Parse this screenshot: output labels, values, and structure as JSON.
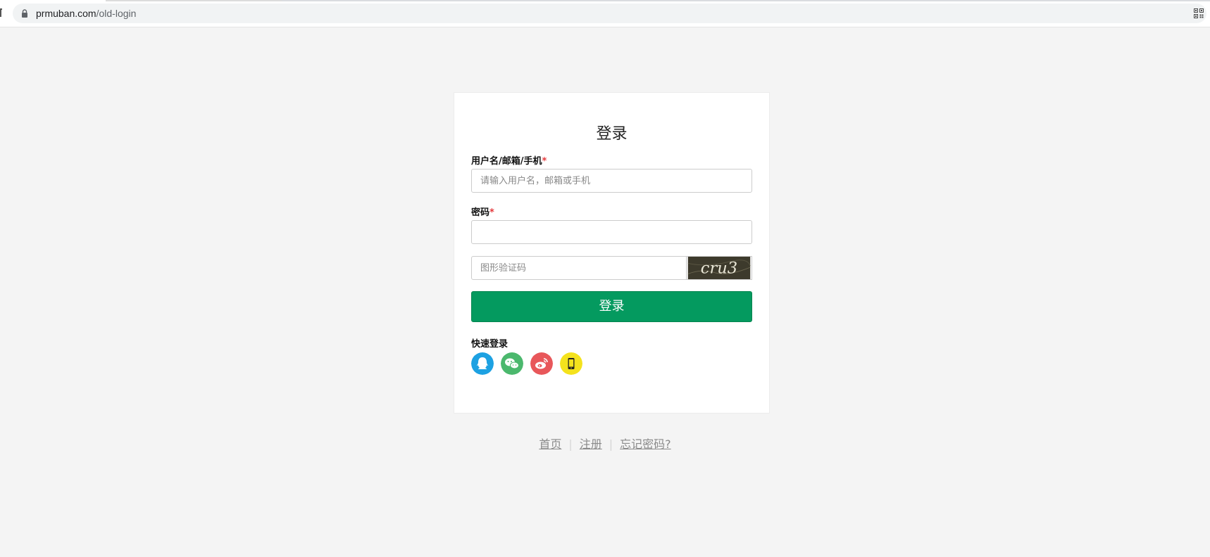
{
  "browser": {
    "url_host": "prmuban.com",
    "url_path": "/old-login"
  },
  "login": {
    "title": "登录",
    "username_label": "用户名/邮箱/手机",
    "username_placeholder": "请输入用户名，邮箱或手机",
    "password_label": "密码",
    "required_mark": "*",
    "captcha_placeholder": "图形验证码",
    "captcha_text": "cru3",
    "submit_label": "登录",
    "quick_login_label": "快速登录",
    "social": [
      {
        "icon": "qq-icon",
        "color": "#1da1e2"
      },
      {
        "icon": "wechat-icon",
        "color": "#4bb86d"
      },
      {
        "icon": "weibo-icon",
        "color": "#e8575a"
      },
      {
        "icon": "phone-icon",
        "color": "#f4e21d"
      }
    ]
  },
  "footer": {
    "home": "首页",
    "register": "注册",
    "forgot": "忘记密码?",
    "separator": "|"
  },
  "colors": {
    "primary": "#049a5f",
    "required": "#e4393c",
    "background": "#f4f4f4"
  }
}
